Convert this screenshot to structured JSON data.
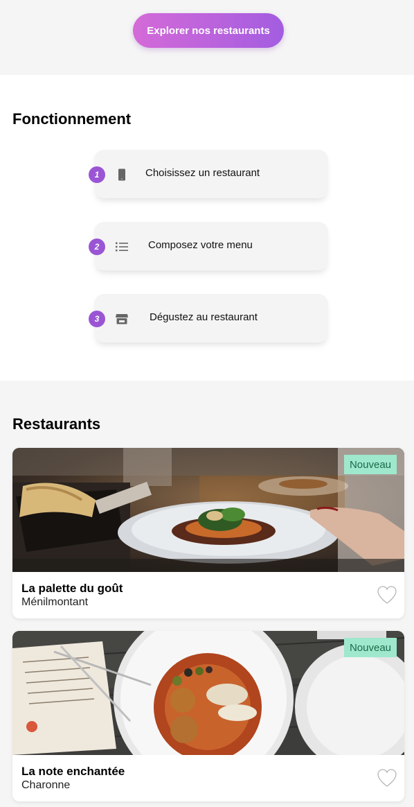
{
  "header": {
    "explore_label": "Explorer nos restaurants",
    "button_gradient": [
      "#d46ad8",
      "#a35de0"
    ]
  },
  "how_it_works": {
    "title": "Fonctionnement",
    "steps": [
      {
        "number": "1",
        "icon": "phone-icon",
        "label": "Choisissez un restaurant"
      },
      {
        "number": "2",
        "icon": "list-icon",
        "label": "Composez votre menu"
      },
      {
        "number": "3",
        "icon": "store-icon",
        "label": "Dégustez au restaurant"
      }
    ],
    "accent_color": "#9a55d4"
  },
  "restaurants": {
    "title": "Restaurants",
    "items": [
      {
        "name": "La palette du goût",
        "area": "Ménilmontant",
        "badge": "Nouveau",
        "favorite_icon": "heart-outline-icon"
      },
      {
        "name": "La note enchantée",
        "area": "Charonne",
        "badge": "Nouveau",
        "favorite_icon": "heart-outline-icon"
      }
    ],
    "badge_color": "#9fe8cd"
  }
}
